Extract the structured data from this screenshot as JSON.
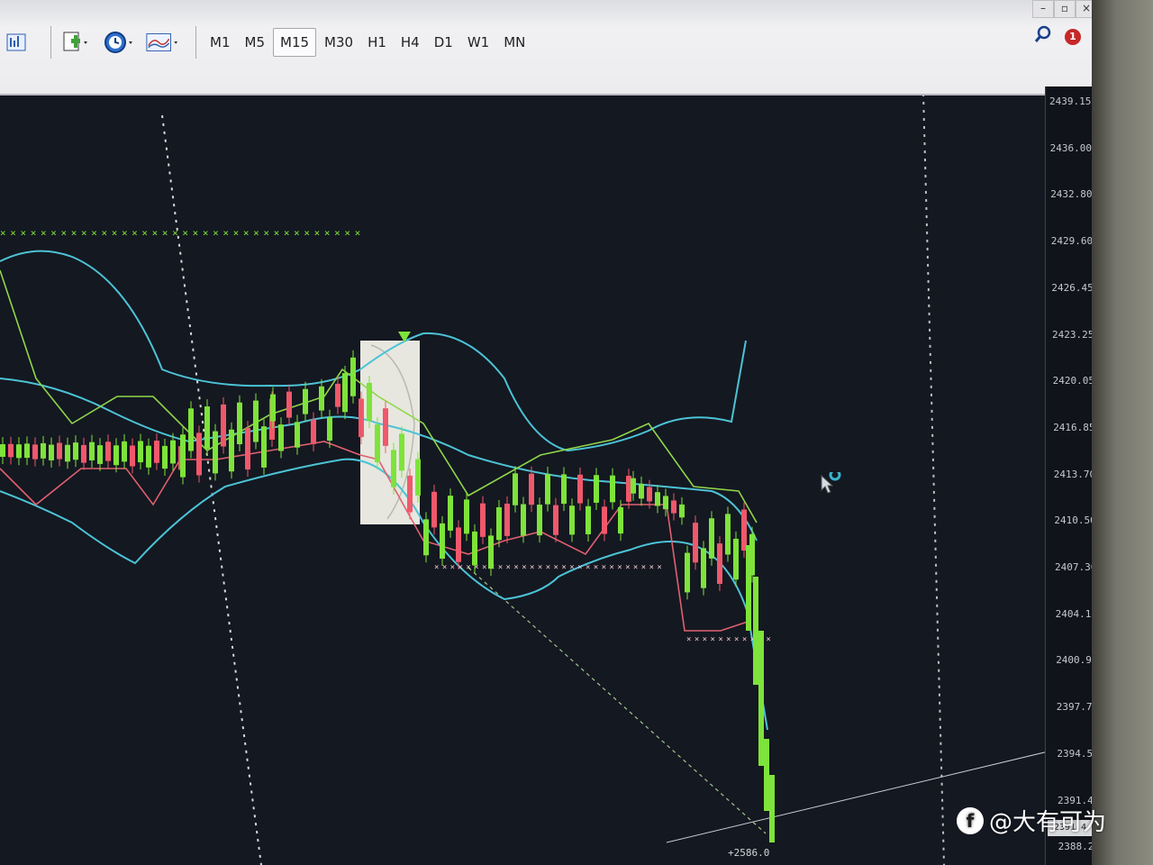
{
  "toolbar": {
    "timeframes": [
      "M1",
      "M5",
      "M15",
      "M30",
      "H1",
      "H4",
      "D1",
      "W1",
      "MN"
    ],
    "active_timeframe": "M15",
    "notification_count": "1",
    "window_controls": [
      "–",
      "▫",
      "×"
    ]
  },
  "price_axis": {
    "ticks": [
      "2439.15",
      "2436.00",
      "2432.80",
      "2429.60",
      "2426.45",
      "2423.25",
      "2420.05",
      "2416.85",
      "2413.70",
      "2410.50",
      "2407.30",
      "2404.15",
      "2400.95",
      "2397.75",
      "2394.55",
      "2391.40",
      "2388.20"
    ],
    "current_price": "2391.4"
  },
  "bottom_label": "+2586.0",
  "watermark": {
    "text": "@大有可为",
    "badge": "f"
  },
  "colors": {
    "background": "#141821",
    "bull_candle": "#7ee33a",
    "bear_candle": "#f0586b",
    "band_cyan": "#4cc3d6",
    "band_green": "#8fd64a",
    "band_red": "#e06070",
    "marker": "#7ee33a"
  }
}
